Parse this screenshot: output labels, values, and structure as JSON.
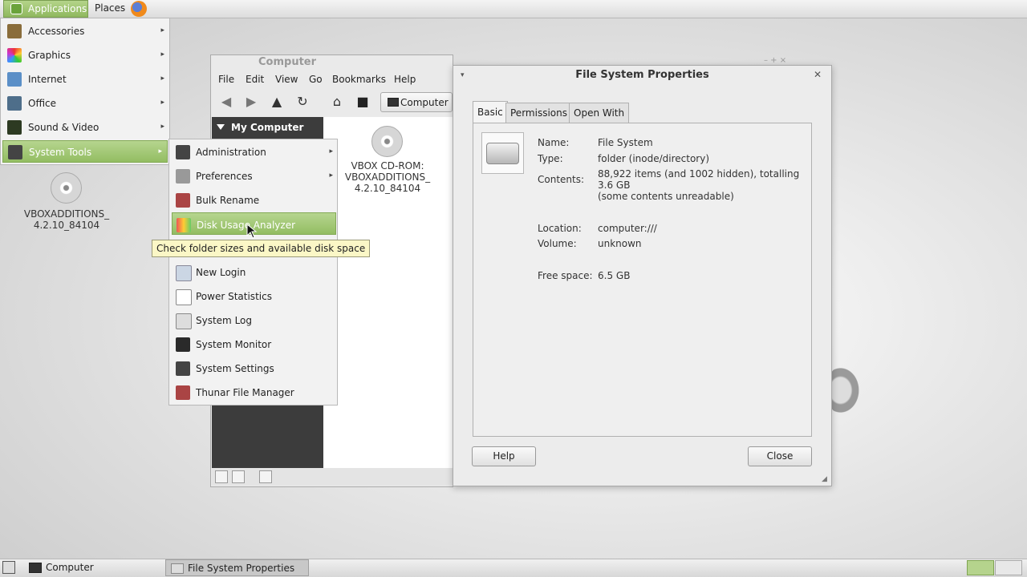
{
  "top_panel": {
    "applications_label": "Applications",
    "places_label": "Places"
  },
  "apps_menu": {
    "items": [
      {
        "label": "Accessories"
      },
      {
        "label": "Graphics"
      },
      {
        "label": "Internet"
      },
      {
        "label": "Office"
      },
      {
        "label": "Sound & Video"
      },
      {
        "label": "System Tools"
      }
    ]
  },
  "system_tools_menu": {
    "items": [
      {
        "label": "Administration"
      },
      {
        "label": "Preferences"
      },
      {
        "label": "Bulk Rename"
      },
      {
        "label": "Disk Usage Analyzer"
      },
      {
        "label": "New Login"
      },
      {
        "label": "Power Statistics"
      },
      {
        "label": "System Log"
      },
      {
        "label": "System Monitor"
      },
      {
        "label": "System Settings"
      },
      {
        "label": "Thunar File Manager"
      }
    ],
    "tooltip": "Check folder sizes and available disk space"
  },
  "desktop": {
    "vbox_icon_label_1": "VBOXADDITIONS_",
    "vbox_icon_label_2": "4.2.10_84104"
  },
  "file_manager": {
    "title": "Computer",
    "menu": [
      "File",
      "Edit",
      "View",
      "Go",
      "Bookmarks",
      "Help"
    ],
    "path_button": "Computer",
    "side_header": "My Computer",
    "cd_label_1": "VBOX CD-ROM:",
    "cd_label_2": "VBOXADDITIONS_",
    "cd_label_3": "4.2.10_84104"
  },
  "properties": {
    "title": "File System Properties",
    "tabs": [
      "Basic",
      "Permissions",
      "Open With"
    ],
    "active_tab": "Basic",
    "name_label": "Name:",
    "name_value": "File System",
    "type_label": "Type:",
    "type_value": "folder (inode/directory)",
    "contents_label": "Contents:",
    "contents_value_1": "88,922 items (and 1002 hidden), totalling",
    "contents_value_2": "3.6 GB",
    "contents_value_3": "(some contents unreadable)",
    "location_label": "Location:",
    "location_value": "computer:///",
    "volume_label": "Volume:",
    "volume_value": "unknown",
    "free_label": "Free space:",
    "free_value": "6.5 GB",
    "help_button": "Help",
    "close_button": "Close"
  },
  "taskbar": {
    "tasks": [
      {
        "label": "Computer"
      },
      {
        "label": "File System Properties"
      }
    ]
  }
}
